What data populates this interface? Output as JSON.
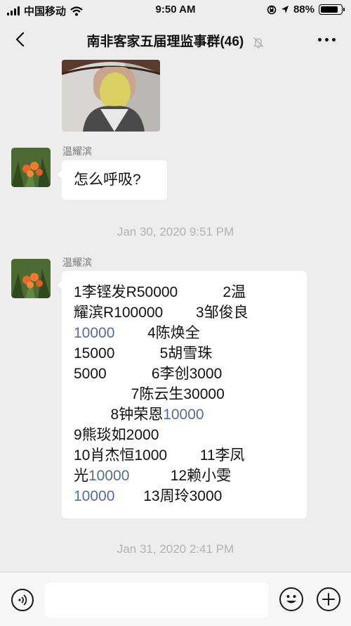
{
  "status_bar": {
    "carrier": "中国移动",
    "time": "9:50 AM",
    "battery_text": "88%",
    "battery_level": 0.88
  },
  "nav": {
    "title": "南非客家五届理监事群(46)"
  },
  "messages": [
    {
      "type": "image"
    },
    {
      "type": "text",
      "sender": "温耀滨",
      "text": "怎么呼吸?"
    },
    {
      "type": "timestamp",
      "text": "Jan 30, 2020 9:51 PM"
    },
    {
      "type": "text",
      "sender": "温耀滨",
      "lines": [
        [
          "1李铿发R50000",
          "",
          "           2温"
        ],
        [
          "耀滨R100000",
          "",
          "        3邹俊良"
        ],
        [
          "",
          "10000",
          "        4陈焕全"
        ],
        [
          "15000",
          "",
          "           5胡雪珠"
        ],
        [
          "5000",
          "",
          "           6李创3000"
        ],
        [
          "              7陈云生30000",
          "",
          ""
        ],
        [
          "         8钟荣恩",
          "10000",
          ""
        ],
        [
          "9熊琰如2000",
          "",
          ""
        ],
        [
          "10肖杰恒1000",
          "",
          "        11李凤"
        ],
        [
          "光",
          "10000",
          "          12赖小雯"
        ],
        [
          "",
          "10000",
          "       13周玲3000"
        ]
      ]
    },
    {
      "type": "timestamp",
      "text": "Jan 31, 2020 2:41 PM"
    }
  ],
  "input_bar": {
    "value": ""
  },
  "icons": {
    "back": "chevron-left-icon",
    "mute": "bell-slash-icon",
    "more": "more-dots-icon",
    "voice": "voice-icon",
    "emoji": "emoji-icon",
    "plus": "plus-icon"
  }
}
